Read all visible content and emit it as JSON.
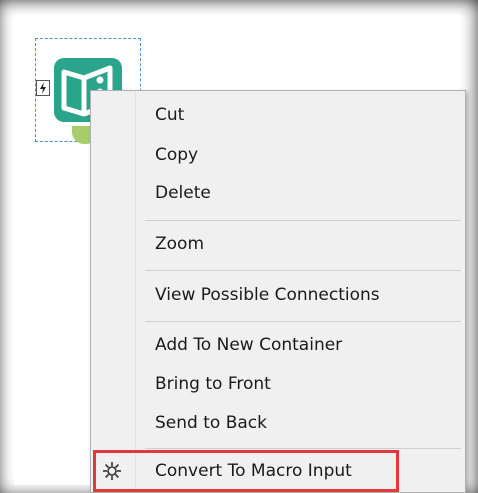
{
  "menu": {
    "items": [
      {
        "label": "Cut"
      },
      {
        "label": "Copy"
      },
      {
        "label": "Delete"
      },
      {
        "label": "Zoom"
      },
      {
        "label": "View Possible Connections"
      },
      {
        "label": "Add To New Container"
      },
      {
        "label": "Bring to Front"
      },
      {
        "label": "Send to Back"
      },
      {
        "label": "Convert To Macro Input",
        "icon": "gear-icon",
        "highlighted": true
      }
    ]
  },
  "tool": {
    "icon": "input-book-icon",
    "badge_icon": "lightning-icon"
  },
  "colors": {
    "tool_green": "#2aa48a",
    "anchor_green": "#a8cc6a",
    "selection_blue": "#4a8fd6",
    "highlight_red": "#e0393b"
  }
}
